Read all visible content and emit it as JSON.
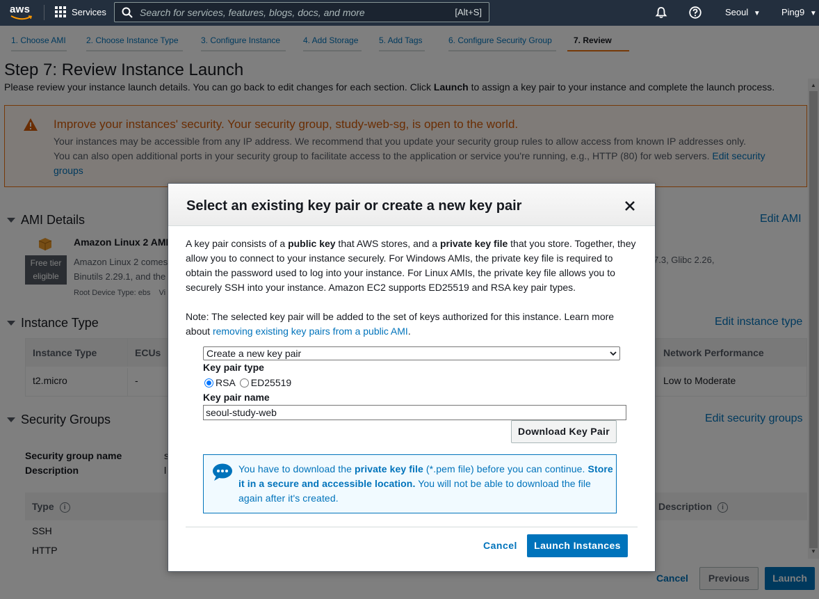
{
  "topnav": {
    "logo_text": "aws",
    "services_label": "Services",
    "search_placeholder": "Search for services, features, blogs, docs, and more",
    "search_shortcut": "[Alt+S]",
    "region": "Seoul",
    "account": "Ping9"
  },
  "steps": [
    {
      "label": "1. Choose AMI"
    },
    {
      "label": "2. Choose Instance Type"
    },
    {
      "label": "3. Configure Instance"
    },
    {
      "label": "4. Add Storage"
    },
    {
      "label": "5. Add Tags"
    },
    {
      "label": "6. Configure Security Group"
    },
    {
      "label": "7. Review"
    }
  ],
  "page": {
    "title": "Step 7: Review Instance Launch",
    "intro_pre": "Please review your instance launch details. You can go back to edit changes for each section. Click ",
    "intro_bold": "Launch",
    "intro_post": " to assign a key pair to your instance and complete the launch process."
  },
  "warning": {
    "title": "Improve your instances' security. Your security group, study-web-sg, is open to the world.",
    "line1": "Your instances may be accessible from any IP address. We recommend that you update your security group rules to allow access from known IP addresses only.",
    "line2": "You can also open additional ports in your security group to facilitate access to the application or service you're running, e.g., HTTP (80) for web servers.",
    "link": "Edit security groups"
  },
  "ami": {
    "heading": "AMI Details",
    "edit": "Edit AMI",
    "name": "Amazon Linux 2 AMI",
    "desc_line1": "Amazon Linux 2 comes",
    "desc_line2": "Binutils 2.29.1, and the",
    "desc_right": "7.3, Glibc 2.26,",
    "free_tier_1": "Free tier",
    "free_tier_2": "eligible",
    "root": "Root Device Type: ebs",
    "root_tail": "Vi"
  },
  "instance_type": {
    "heading": "Instance Type",
    "edit": "Edit instance type",
    "headers": [
      "Instance Type",
      "ECUs",
      "Network Performance"
    ],
    "row": [
      "t2.micro",
      "-",
      "Low to Moderate"
    ]
  },
  "security_groups": {
    "heading": "Security Groups",
    "edit": "Edit security groups",
    "name_label": "Security group name",
    "name_value": "s",
    "desc_label": "Description",
    "desc_value": "l",
    "col_type": "Type",
    "col_desc": "Description",
    "rows": [
      "SSH",
      "HTTP"
    ]
  },
  "footer": {
    "cancel": "Cancel",
    "previous": "Previous",
    "launch": "Launch"
  },
  "modal": {
    "title": "Select an existing key pair or create a new key pair",
    "p1_a": "A key pair consists of a ",
    "p1_b": "public key",
    "p1_c": " that AWS stores, and a ",
    "p1_d": "private key file",
    "p1_e": " that you store. Together, they allow you to connect to your instance securely. For Windows AMIs, the private key file is required to obtain the password used to log into your instance. For Linux AMIs, the private key file allows you to securely SSH into your instance. Amazon EC2 supports ED25519 and RSA key pair types.",
    "note_pre": "Note: The selected key pair will be added to the set of keys authorized for this instance. Learn more about ",
    "note_link": "removing existing key pairs from a public AMI",
    "note_post": ".",
    "select_value": "Create a new key pair",
    "type_label": "Key pair type",
    "radio_rsa": "RSA",
    "radio_ed": "ED25519",
    "name_label": "Key pair name",
    "name_value": "seoul-study-web",
    "download_btn": "Download Key Pair",
    "info_a": "You have to download the ",
    "info_b": "private key file",
    "info_c": " (*.pem file) before you can continue. ",
    "info_d": "Store it in a secure and accessible location.",
    "info_e": " You will not be able to download the file again after it's created.",
    "cancel": "Cancel",
    "launch": "Launch Instances"
  },
  "colors": {
    "nav_bg": "#232f3e",
    "link": "#0073bb",
    "warning": "#ec7211",
    "primary_button": "#0073bb"
  }
}
